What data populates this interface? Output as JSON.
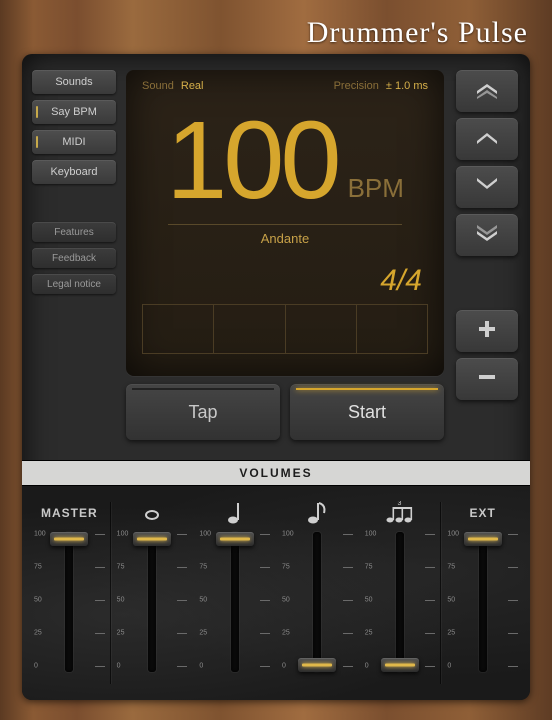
{
  "app_title": "Drummer's Pulse",
  "sidebar": {
    "main": [
      {
        "label": "Sounds",
        "indicator": false
      },
      {
        "label": "Say BPM",
        "indicator": true
      },
      {
        "label": "MIDI",
        "indicator": true
      },
      {
        "label": "Keyboard",
        "indicator": false
      }
    ],
    "secondary": [
      {
        "label": "Features"
      },
      {
        "label": "Feedback"
      },
      {
        "label": "Legal notice"
      }
    ]
  },
  "display": {
    "sound_label": "Sound",
    "sound_value": "Real",
    "precision_label": "Precision",
    "precision_value": "± 1.0 ms",
    "bpm": "100",
    "bpm_unit": "BPM",
    "tempo_name": "Andante",
    "time_signature": "4/4",
    "beat_count": 4
  },
  "right_buttons": [
    {
      "name": "big-up"
    },
    {
      "name": "step-up"
    },
    {
      "name": "step-down"
    },
    {
      "name": "big-down"
    },
    {
      "name": "plus"
    },
    {
      "name": "minus"
    }
  ],
  "actions": {
    "tap": "Tap",
    "start": "Start"
  },
  "volumes_title": "VOLUMES",
  "faders": [
    {
      "label": "MASTER",
      "icon": "",
      "value": 100,
      "sep": true
    },
    {
      "label": "",
      "icon": "whole",
      "value": 100,
      "sep": false
    },
    {
      "label": "",
      "icon": "quarter",
      "value": 100,
      "sep": false
    },
    {
      "label": "",
      "icon": "eighth",
      "value": 0,
      "sep": false
    },
    {
      "label": "",
      "icon": "triplet",
      "value": 0,
      "sep": true
    },
    {
      "label": "EXT",
      "icon": "",
      "value": 100,
      "sep": false
    }
  ],
  "scale_marks": [
    0,
    25,
    50,
    75,
    100
  ]
}
